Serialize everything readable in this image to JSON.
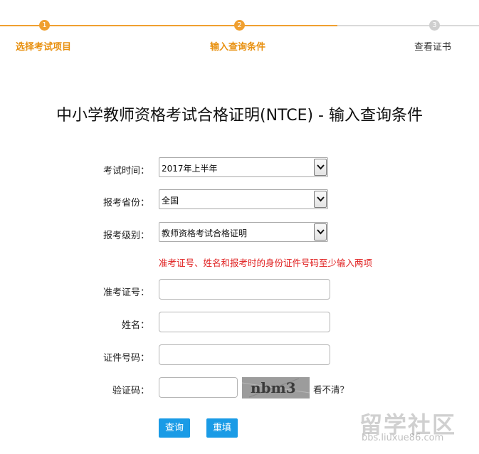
{
  "steps": [
    {
      "num": "1",
      "label": "选择考试项目",
      "state": "done"
    },
    {
      "num": "2",
      "label": "输入查询条件",
      "state": "current"
    },
    {
      "num": "3",
      "label": "查看证书",
      "state": "todo"
    }
  ],
  "page_title": "中小学教师资格考试合格证明(NTCE) - 输入查询条件",
  "form": {
    "exam_time": {
      "label": "考试时间：",
      "value": "2017年上半年"
    },
    "province": {
      "label": "报考省份：",
      "value": "全国"
    },
    "level": {
      "label": "报考级别：",
      "value": "教师资格考试合格证明"
    },
    "hint": "准考证号、姓名和报考时的身份证件号码至少输入两项",
    "ticket_no": {
      "label": "准考证号：",
      "value": ""
    },
    "name": {
      "label": "姓名：",
      "value": ""
    },
    "id_no": {
      "label": "证件号码：",
      "value": ""
    },
    "captcha": {
      "label": "验证码：",
      "value": "",
      "image_text": "nbm3",
      "refresh_label": "看不清？"
    }
  },
  "buttons": {
    "query": "查询",
    "reset": "重填"
  },
  "watermark": {
    "logo": "留学社区",
    "url": "bbs.liuxue86.com"
  },
  "colors": {
    "accent_orange": "#f0a030",
    "hint_red": "#e02020",
    "button_blue": "#1a9be6"
  }
}
